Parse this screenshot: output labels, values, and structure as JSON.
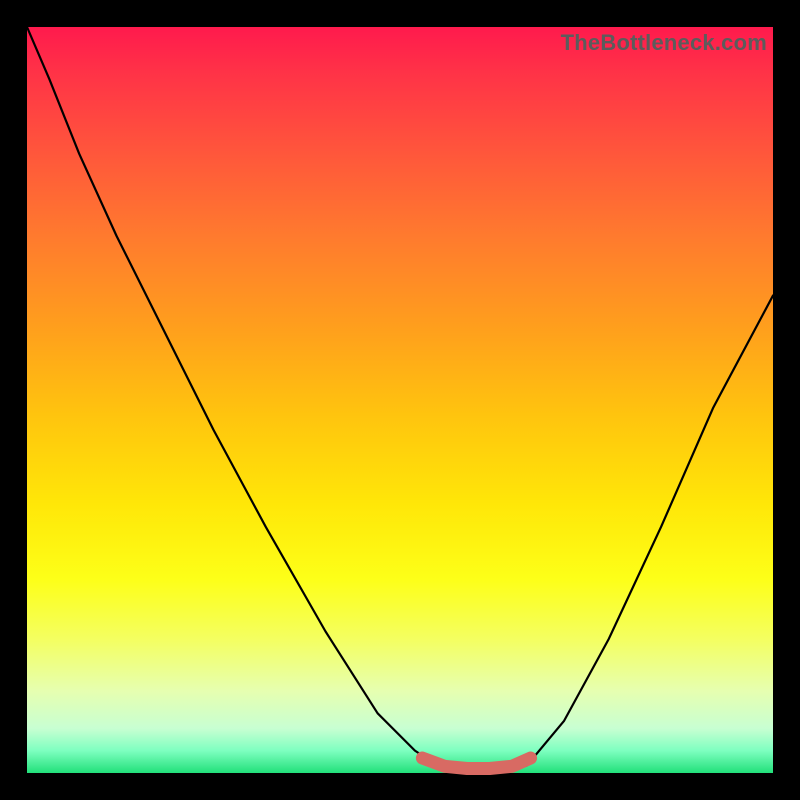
{
  "watermark": {
    "text": "TheBottleneck.com"
  },
  "colors": {
    "background": "#000000",
    "curve": "#000000",
    "highlight": "#d86a63"
  },
  "chart_data": {
    "type": "line",
    "title": "",
    "xlabel": "",
    "ylabel": "",
    "xlim": [
      0,
      100
    ],
    "ylim": [
      0,
      100
    ],
    "grid": false,
    "legend": null,
    "series": [
      {
        "name": "left-branch",
        "x": [
          0,
          3,
          7,
          12,
          18,
          25,
          32,
          40,
          47,
          52,
          55
        ],
        "y": [
          100,
          93,
          83,
          72,
          60,
          46,
          33,
          19,
          8,
          3,
          1
        ]
      },
      {
        "name": "valley-floor",
        "x": [
          55,
          58,
          61,
          64,
          67
        ],
        "y": [
          1,
          0.7,
          0.6,
          0.7,
          1
        ]
      },
      {
        "name": "right-branch",
        "x": [
          67,
          72,
          78,
          85,
          92,
          100
        ],
        "y": [
          1,
          7,
          18,
          33,
          49,
          64
        ]
      }
    ],
    "highlight": {
      "name": "minimum-band",
      "x": [
        53,
        56,
        59,
        62,
        65,
        67.5
      ],
      "y": [
        2.0,
        0.9,
        0.6,
        0.6,
        0.9,
        2.0
      ]
    }
  }
}
